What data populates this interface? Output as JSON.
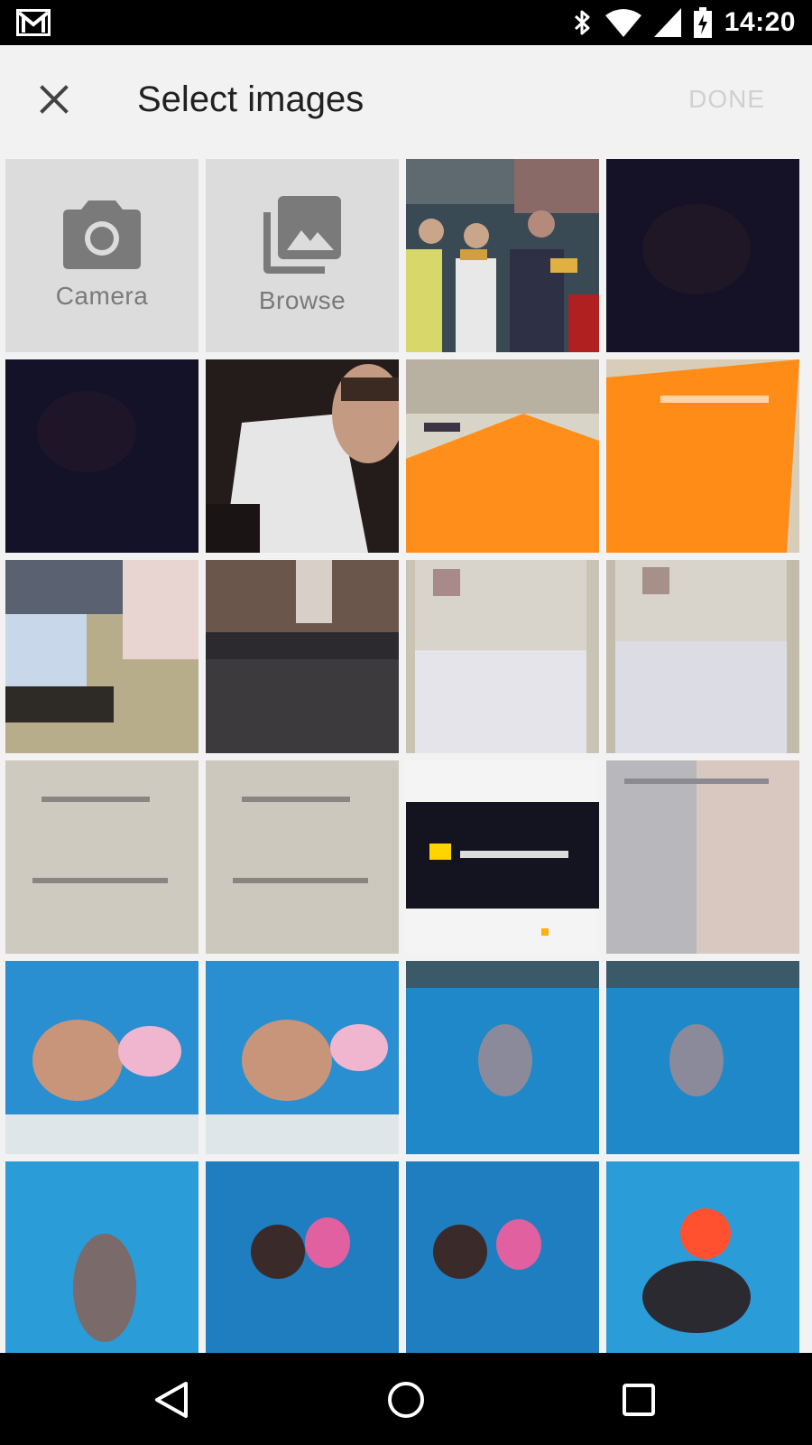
{
  "status_bar": {
    "time": "14:20",
    "icons": [
      "gmail-icon",
      "bluetooth-icon",
      "wifi-icon",
      "signal-icon",
      "battery-icon"
    ]
  },
  "app_bar": {
    "title": "Select images",
    "done_label": "DONE",
    "close_icon": "close-icon"
  },
  "actions": {
    "camera_label": "Camera",
    "browse_label": "Browse"
  },
  "colors": {
    "status_bar_bg": "#000000",
    "app_bg": "#f2f2f2",
    "action_tile_bg": "#dcdcdc",
    "action_icon": "#7a7a7a",
    "done_disabled": "#d0d0d0"
  },
  "thumbnails": [
    "group-photo-thumbnail",
    "dark-photo-thumbnail",
    "dark-photo-thumbnail",
    "selfie-thumbnail",
    "orange-paper-thumbnail",
    "orange-paper-thumbnail",
    "desk-computer-thumbnail",
    "room-interior-thumbnail",
    "document-thumbnail",
    "document-thumbnail",
    "printed-page-thumbnail",
    "printed-page-thumbnail",
    "screenshot-thumbnail",
    "printed-page-thumbnail",
    "pool-photo-thumbnail",
    "pool-photo-thumbnail",
    "pool-photo-thumbnail",
    "pool-photo-thumbnail",
    "pool-photo-thumbnail",
    "pool-photo-thumbnail",
    "pool-photo-thumbnail",
    "pool-photo-thumbnail"
  ],
  "nav_bar": {
    "icons": [
      "back-icon",
      "home-icon",
      "recents-icon"
    ]
  }
}
